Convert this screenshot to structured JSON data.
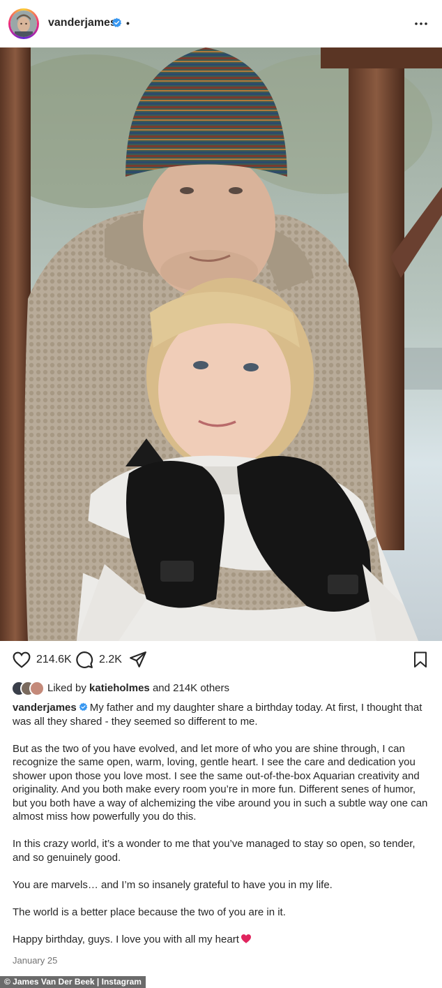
{
  "header": {
    "username": "vanderjames",
    "separator": "•",
    "more_icon": "more-horizontal-icon"
  },
  "photo": {
    "icon": "post-photo"
  },
  "actions": {
    "like_icon": "heart-outline-icon",
    "like_count": "214.6K",
    "comment_icon": "comment-bubble-icon",
    "comment_count": "2.2K",
    "share_icon": "paper-plane-icon",
    "save_icon": "bookmark-icon"
  },
  "likes": {
    "prefix": "Liked by",
    "user": "katieholmes",
    "suffix": "and 214K others"
  },
  "caption": {
    "username": "vanderjames",
    "paragraphs": [
      "My father and my daughter share a birthday today. At first, I thought that was all they shared - they seemed so different to me.",
      "But as the two of you have evolved, and let more of who you are shine through, I can recognize the same open, warm, loving, gentle heart. I see the care and dedication you shower upon those you love most. I see the same out-of-the-box Aquarian creativity and originality. And you both make every room you’re in more fun. Different senes of humor, but you both have a way of alchemizing the vibe around you in such a subtle way one can almost miss how powerfully you do this.",
      "In this crazy world, it’s a wonder to me that you’ve managed to stay so open, so tender, and so genuinely good.",
      "You are marvels… and I’m so insanely grateful to have you in my life.",
      "The world is a better place because the two of you are in it.",
      "Happy birthday, guys. I love you with all my heart"
    ]
  },
  "date": "January 25",
  "credit": "© James Van Der Beek | Instagram",
  "colors": {
    "verified": "#3897f0",
    "text": "#262626",
    "muted": "#737373",
    "heart_emoji": "#e0245e"
  }
}
